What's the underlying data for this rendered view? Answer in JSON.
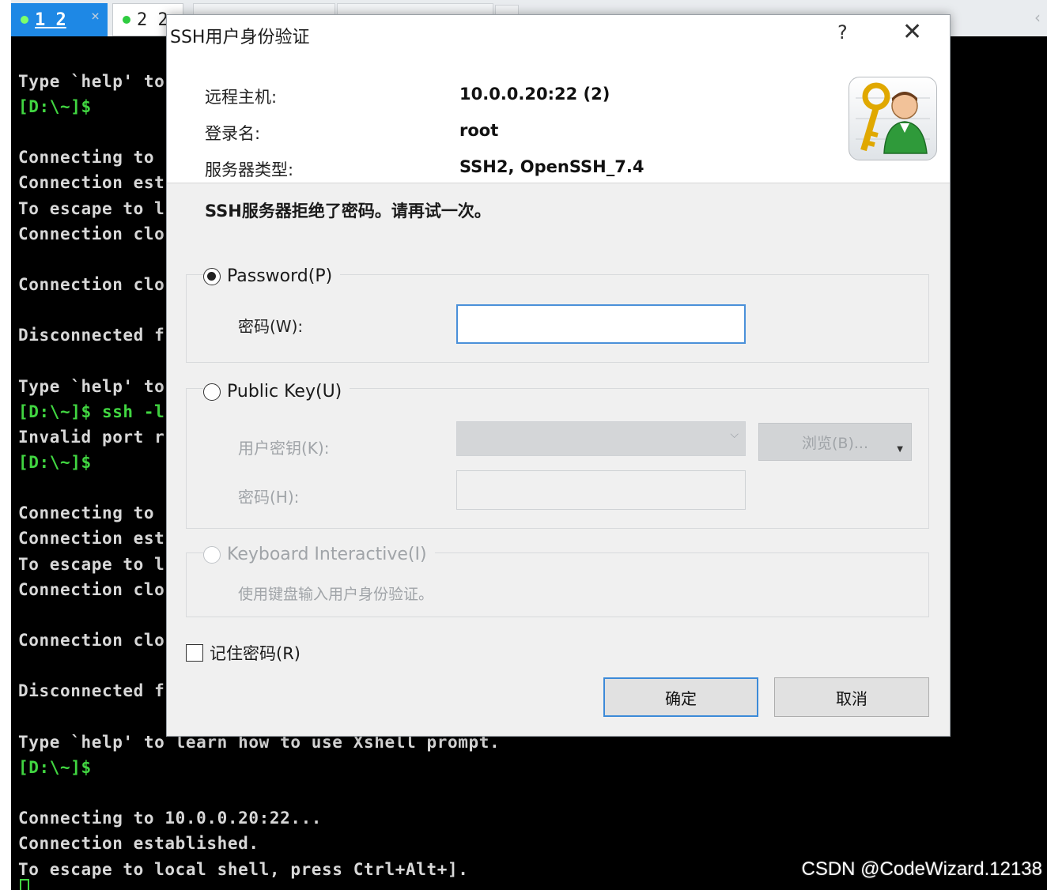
{
  "tabs": [
    {
      "label": "1 2",
      "close": "×"
    },
    {
      "label": "2 2"
    }
  ],
  "terminal": {
    "lines": [
      "Type `help' to",
      "[D:\\~]$",
      "Connecting to",
      "Connection est",
      "To escape to l",
      "Connection clo",
      "Connection clo",
      "Disconnected f",
      "Type `help' to",
      "[D:\\~]$ ssh -l",
      "Invalid port r",
      "[D:\\~]$",
      "Connecting to",
      "Connection est",
      "To escape to l",
      "Connection clo",
      "Connection clo",
      "Disconnected f",
      "Type `help' to learn how to use Xshell prompt.",
      "[D:\\~]$",
      "Connecting to 10.0.0.20:22...",
      "Connection established.",
      "To escape to local shell, press Ctrl+Alt+]."
    ]
  },
  "dialog": {
    "title": "SSH用户身份验证",
    "help": "?",
    "close": "✕",
    "info": {
      "host_label": "远程主机:",
      "host_value": "10.0.0.20:22 (2)",
      "login_label": "登录名:",
      "login_value": "root",
      "server_label": "服务器类型:",
      "server_value": "SSH2, OpenSSH_7.4"
    },
    "error_message": "SSH服务器拒绝了密码。请再试一次。",
    "password_option": "Password(P)",
    "password_label": "密码(W):",
    "password_value": "",
    "pubkey_option": "Public Key(U)",
    "user_key_label": "用户密钥(K):",
    "browse_button": "浏览(B)...",
    "passphrase_label": "密码(H):",
    "kbd_option": "Keyboard Interactive(I)",
    "kbd_description": "使用键盘输入用户身份验证。",
    "remember_label": "记住密码(R)",
    "ok_button": "确定",
    "cancel_button": "取消"
  },
  "watermark": "CSDN @CodeWizard.12138",
  "colors": {
    "tab_active": "#1e88e5",
    "prompt_green": "#41d641",
    "focus_blue": "#4a90d9"
  }
}
